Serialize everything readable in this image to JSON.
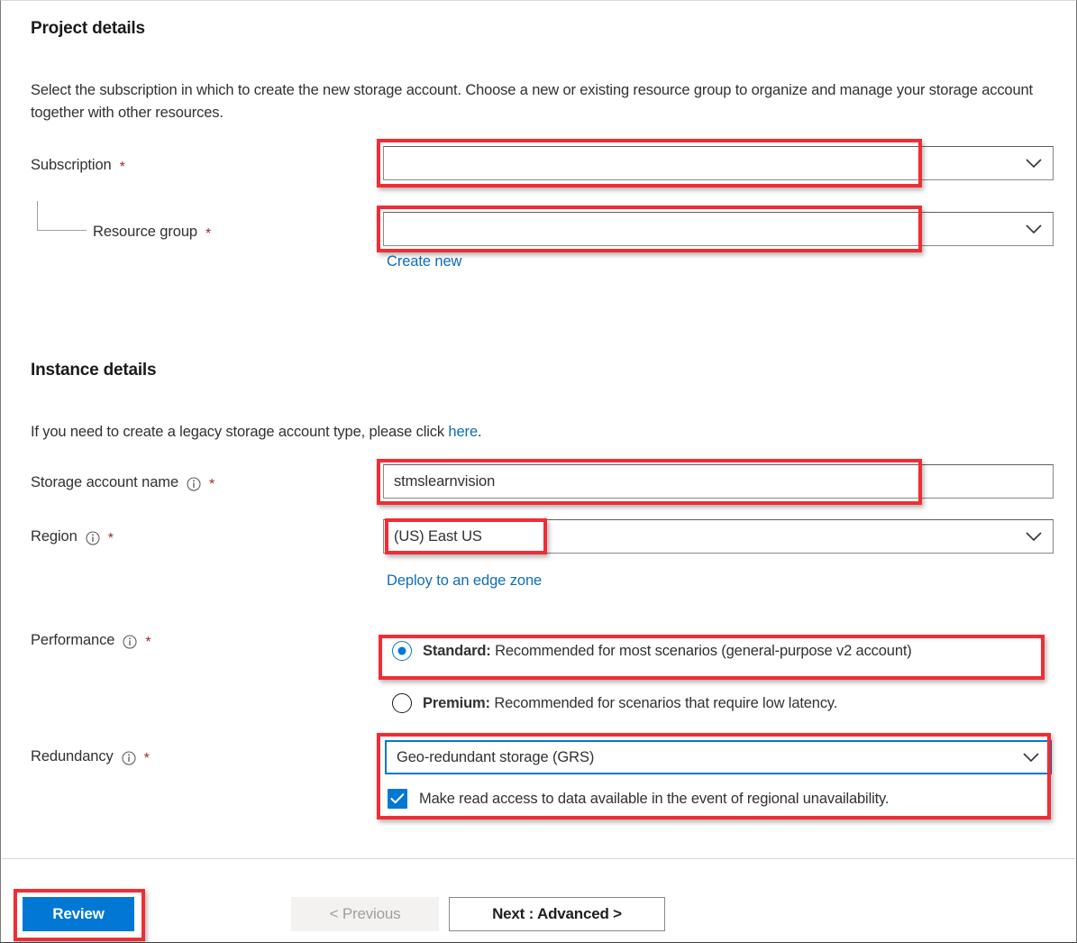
{
  "project_details": {
    "heading": "Project details",
    "description": "Select the subscription in which to create the new storage account. Choose a new or existing resource group to organize and manage your storage account together with other resources.",
    "subscription": {
      "label": "Subscription",
      "required_marker": "*",
      "value": "",
      "chevron_icon": "chevron-down-icon"
    },
    "resource_group": {
      "label": "Resource group",
      "required_marker": "*",
      "value": "",
      "chevron_icon": "chevron-down-icon",
      "create_new_link": "Create new"
    }
  },
  "instance_details": {
    "heading": "Instance details",
    "legacy_text_before": "If you need to create a legacy storage account type, please click ",
    "legacy_link": "here",
    "legacy_text_after": ".",
    "storage_account_name": {
      "label": "Storage account name",
      "info_icon": "info-icon",
      "required_marker": "*",
      "value": "stmslearnvision"
    },
    "region": {
      "label": "Region",
      "info_icon": "info-icon",
      "required_marker": "*",
      "value": "(US) East US",
      "chevron_icon": "chevron-down-icon",
      "edge_zone_link": "Deploy to an edge zone"
    },
    "performance": {
      "label": "Performance",
      "info_icon": "info-icon",
      "required_marker": "*",
      "options": [
        {
          "name": "Standard:",
          "description": " Recommended for most scenarios (general-purpose v2 account)",
          "selected": true
        },
        {
          "name": "Premium:",
          "description": " Recommended for scenarios that require low latency.",
          "selected": false
        }
      ]
    },
    "redundancy": {
      "label": "Redundancy",
      "info_icon": "info-icon",
      "required_marker": "*",
      "value": "Geo-redundant storage (GRS)",
      "chevron_icon": "chevron-down-icon",
      "checkbox_label": "Make read access to data available in the event of regional unavailability.",
      "checkbox_checked": true
    }
  },
  "footer": {
    "review_button": "Review",
    "previous_button": "< Previous",
    "next_button": "Next : Advanced >"
  },
  "colors": {
    "accent_blue": "#0078d4",
    "link_blue": "#0f6cbd",
    "annotation_red": "#f02d34",
    "required_red": "#a4262c",
    "text": "#323130"
  }
}
